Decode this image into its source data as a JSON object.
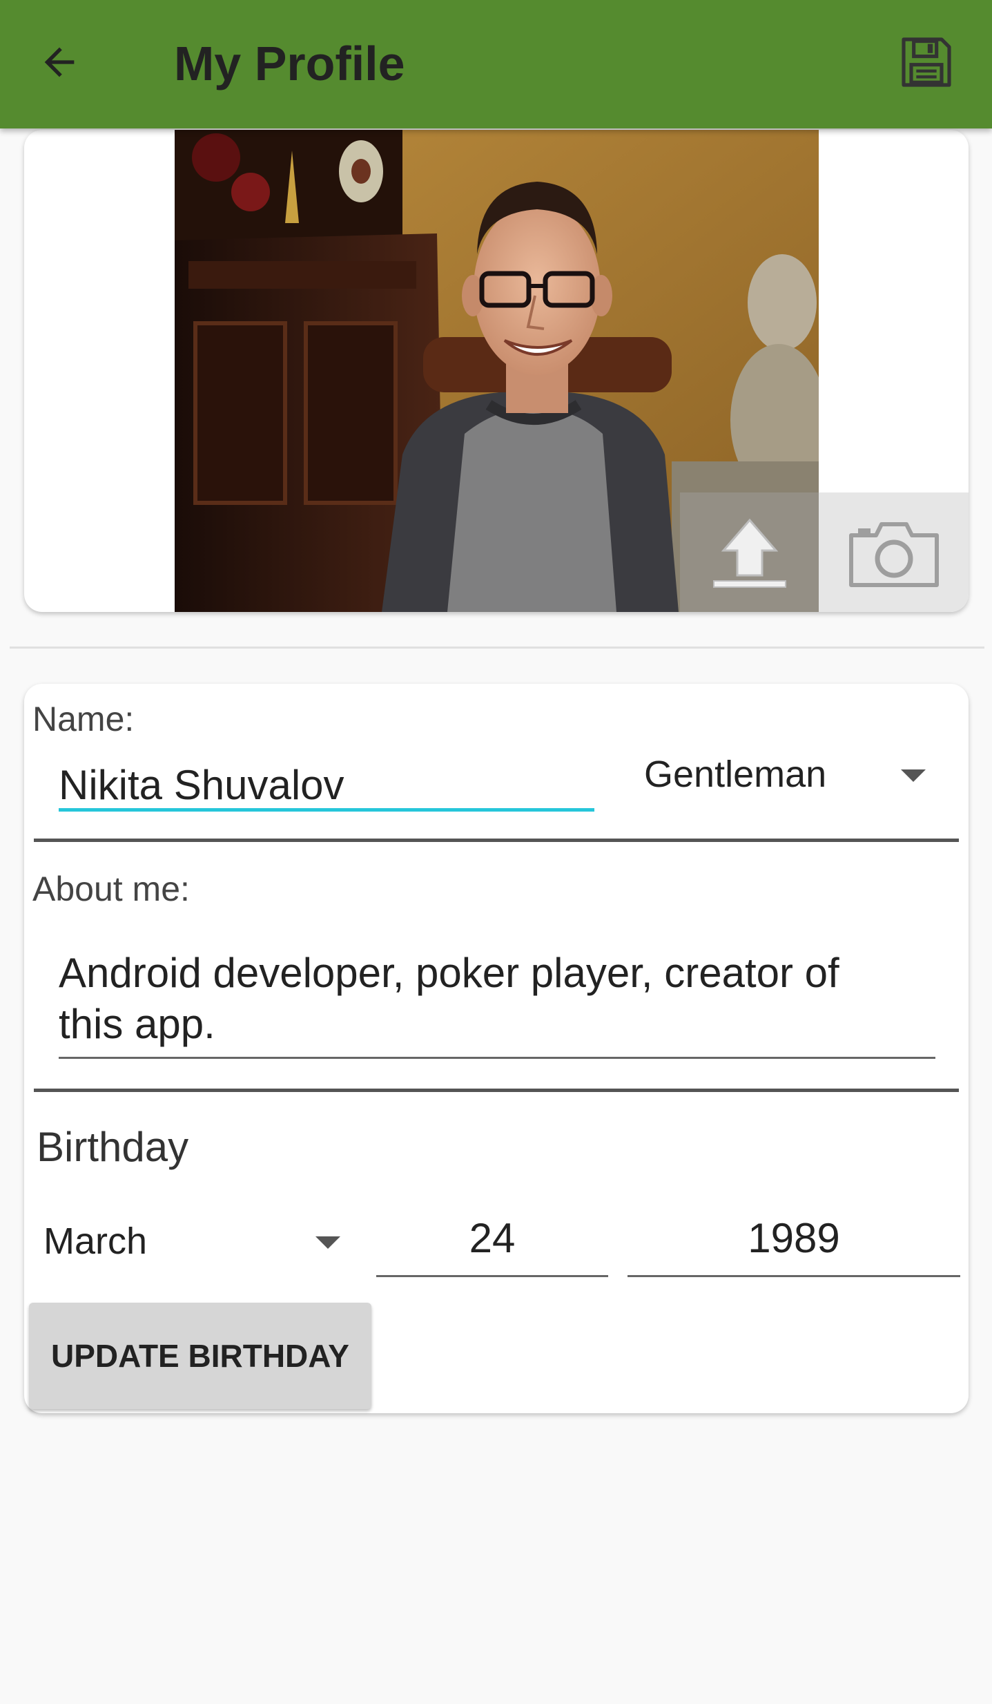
{
  "app_bar": {
    "title": "My Profile",
    "back_icon": "arrow-left-icon",
    "save_icon": "floppy-disk-icon",
    "color": "#558b2f"
  },
  "photo_card": {
    "upload_icon": "upload-icon",
    "camera_icon": "camera-icon"
  },
  "form": {
    "name_label": "Name:",
    "name_value": "Nikita Shuvalov",
    "title_select_value": "Gentleman",
    "about_label": "About me:",
    "about_value": "Android developer, poker player, creator of this app.",
    "birthday_label": "Birthday",
    "month_value": "March",
    "day_value": "24",
    "year_value": "1989",
    "update_button_label": "UPDATE BIRTHDAY",
    "accent_color": "#26c6da"
  }
}
